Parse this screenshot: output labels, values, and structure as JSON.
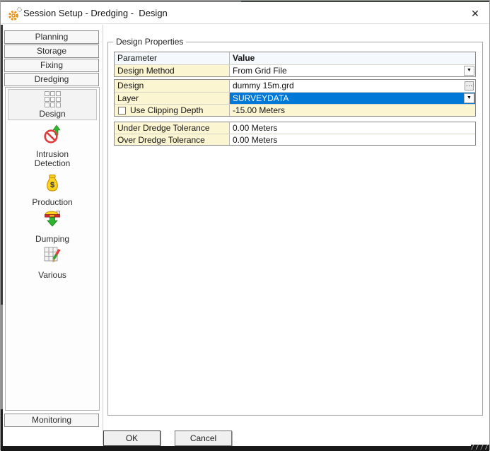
{
  "window": {
    "title": "Session Setup - Dredging -  Design"
  },
  "glyphs": {
    "close": "✕",
    "dropdown": "▼",
    "ellipsis": "…"
  },
  "colors": {
    "selection_blue": "#0078D7",
    "parameter_yellow": "#FBF5D1",
    "gear_orange": "#E8941A"
  },
  "sidebar": {
    "top_buttons": [
      {
        "label": "Planning"
      },
      {
        "label": "Storage"
      },
      {
        "label": "Fixing"
      },
      {
        "label": "Dredging"
      }
    ],
    "dredging_panel": {
      "items": [
        {
          "label": "Design",
          "selected": true
        },
        {
          "label": "Intrusion Detection",
          "selected": false
        },
        {
          "label": "Production",
          "selected": false
        },
        {
          "label": "Dumping",
          "selected": false
        },
        {
          "label": "Various",
          "selected": false
        }
      ]
    },
    "bottom_buttons": [
      {
        "label": "Monitoring"
      }
    ]
  },
  "main": {
    "group_title": "Design Properties",
    "table": {
      "headers": [
        "Parameter",
        "Value"
      ],
      "groups": [
        {
          "rows": [
            {
              "param": "Design Method",
              "value": "From Grid File",
              "control": "dropdown"
            }
          ]
        },
        {
          "rows": [
            {
              "param": "Design",
              "value": "dummy 15m.grd",
              "control": "ellipsis"
            },
            {
              "param": "Layer",
              "value": "SURVEYDATA",
              "control": "dropdown",
              "selected": true
            },
            {
              "param": "Use Clipping Depth",
              "value": "-15.00 Meters",
              "checkbox_checked": false
            }
          ]
        },
        {
          "rows": [
            {
              "param": "Under Dredge Tolerance",
              "value": "0.00 Meters"
            },
            {
              "param": "Over Dredge Tolerance",
              "value": "0.00 Meters"
            }
          ]
        }
      ]
    }
  },
  "footer": {
    "ok_label": "OK",
    "cancel_label": "Cancel"
  }
}
